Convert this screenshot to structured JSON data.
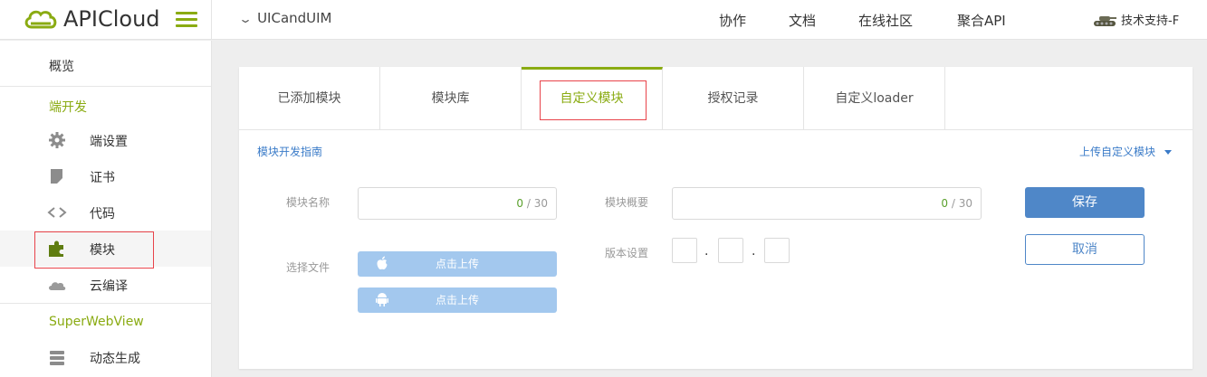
{
  "header": {
    "logo_text": "APICloud",
    "app_name": "UICandUIM",
    "nav": [
      "协作",
      "文档",
      "在线社区",
      "聚合API"
    ],
    "user": "技术支持-F"
  },
  "sidebar": {
    "overview": "概览",
    "section_client": "端开发",
    "items": [
      {
        "label": "端设置",
        "icon": "gear-icon"
      },
      {
        "label": "证书",
        "icon": "certificate-icon"
      },
      {
        "label": "代码",
        "icon": "code-icon"
      },
      {
        "label": "模块",
        "icon": "puzzle-icon"
      },
      {
        "label": "云编译",
        "icon": "cloud-icon"
      }
    ],
    "section_superwebview": "SuperWebView",
    "items2": [
      {
        "label": "动态生成",
        "icon": "layers-icon"
      }
    ]
  },
  "tabs": [
    {
      "label": "已添加模块",
      "active": false
    },
    {
      "label": "模块库",
      "active": false
    },
    {
      "label": "自定义模块",
      "active": true
    },
    {
      "label": "授权记录",
      "active": false
    },
    {
      "label": "自定义loader",
      "active": false
    }
  ],
  "form": {
    "guide_link": "模块开发指南",
    "upload_custom": "上传自定义模块",
    "name_label": "模块名称",
    "name_count": "0",
    "name_max": "/ 30",
    "summary_label": "模块概要",
    "summary_count": "0",
    "summary_max": "/ 30",
    "file_label": "选择文件",
    "upload_ios": "点击上传",
    "upload_android": "点击上传",
    "version_label": "版本设置",
    "version_sep": ".",
    "save": "保存",
    "cancel": "取消"
  },
  "colors": {
    "accent_green": "#8aab12",
    "link_blue": "#3a7bc8",
    "primary_blue": "#4f87c8",
    "upload_blue": "#a3c8ee",
    "highlight_red": "#e8434a"
  }
}
